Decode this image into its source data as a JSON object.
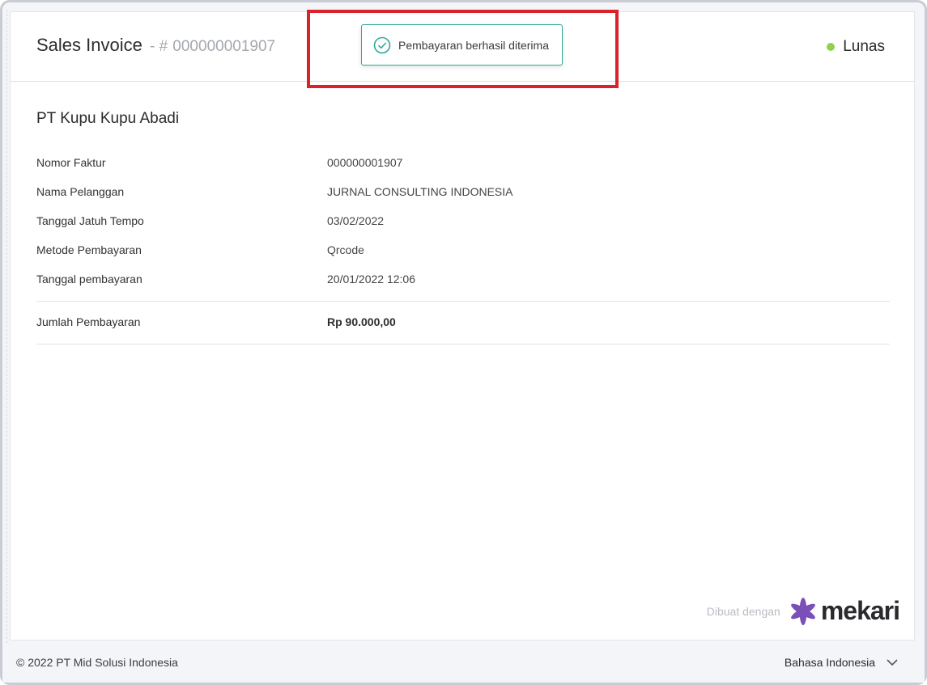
{
  "header": {
    "title": "Sales Invoice",
    "separator": "- #",
    "invoice_number": "000000001907",
    "status": "Lunas",
    "status_color": "#8fd14f"
  },
  "toast": {
    "message": "Pembayaran berhasil diterima",
    "icon": "check-circle-icon",
    "accent": "#2fa89a"
  },
  "invoice": {
    "company": "PT Kupu Kupu Abadi",
    "rows": [
      {
        "label": "Nomor Faktur",
        "value": "000000001907"
      },
      {
        "label": "Nama Pelanggan",
        "value": "JURNAL CONSULTING INDONESIA"
      },
      {
        "label": "Tanggal Jatuh Tempo",
        "value": "03/02/2022"
      },
      {
        "label": "Metode Pembayaran",
        "value": "Qrcode"
      },
      {
        "label": "Tanggal pembayaran",
        "value": "20/01/2022 12:06"
      }
    ],
    "total": {
      "label": "Jumlah Pembayaran",
      "value": "Rp 90.000,00"
    }
  },
  "branding": {
    "made_by": "Dibuat dengan",
    "logo": "mekari",
    "logo_color": "#7b4fb8"
  },
  "footer": {
    "copyright": "© 2022 PT Mid Solusi Indonesia",
    "language": "Bahasa Indonesia",
    "language_icon": "chevron-down-icon"
  },
  "annotation": {
    "highlight_color": "#d9222a"
  }
}
